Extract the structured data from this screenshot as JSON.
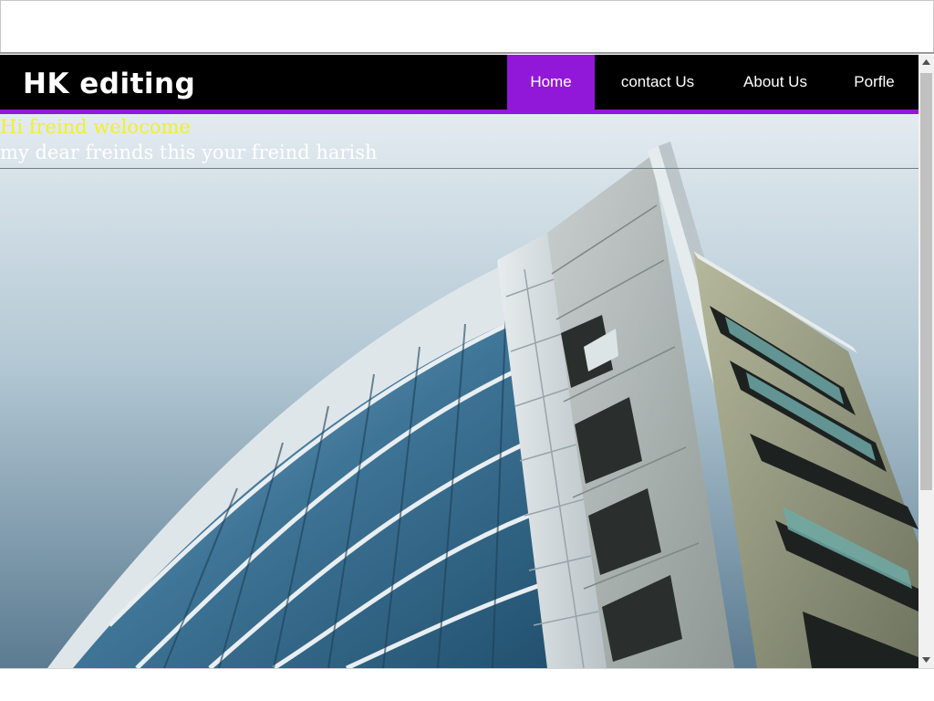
{
  "site": {
    "logo": "HK editing"
  },
  "nav": {
    "items": [
      {
        "label": "Home",
        "active": true
      },
      {
        "label": "contact Us",
        "active": false
      },
      {
        "label": "About Us",
        "active": false
      },
      {
        "label": "Porfle",
        "active": false
      }
    ]
  },
  "hero": {
    "greeting_line1": "Hi freind welocome",
    "greeting_line2": "my dear freinds this your freind harish",
    "image": "modern-office-building-photo"
  },
  "colors": {
    "header_bg": "#000000",
    "accent": "#9218d9",
    "greeting_line1": "#f3ef2a",
    "greeting_line2": "#ffffff"
  }
}
